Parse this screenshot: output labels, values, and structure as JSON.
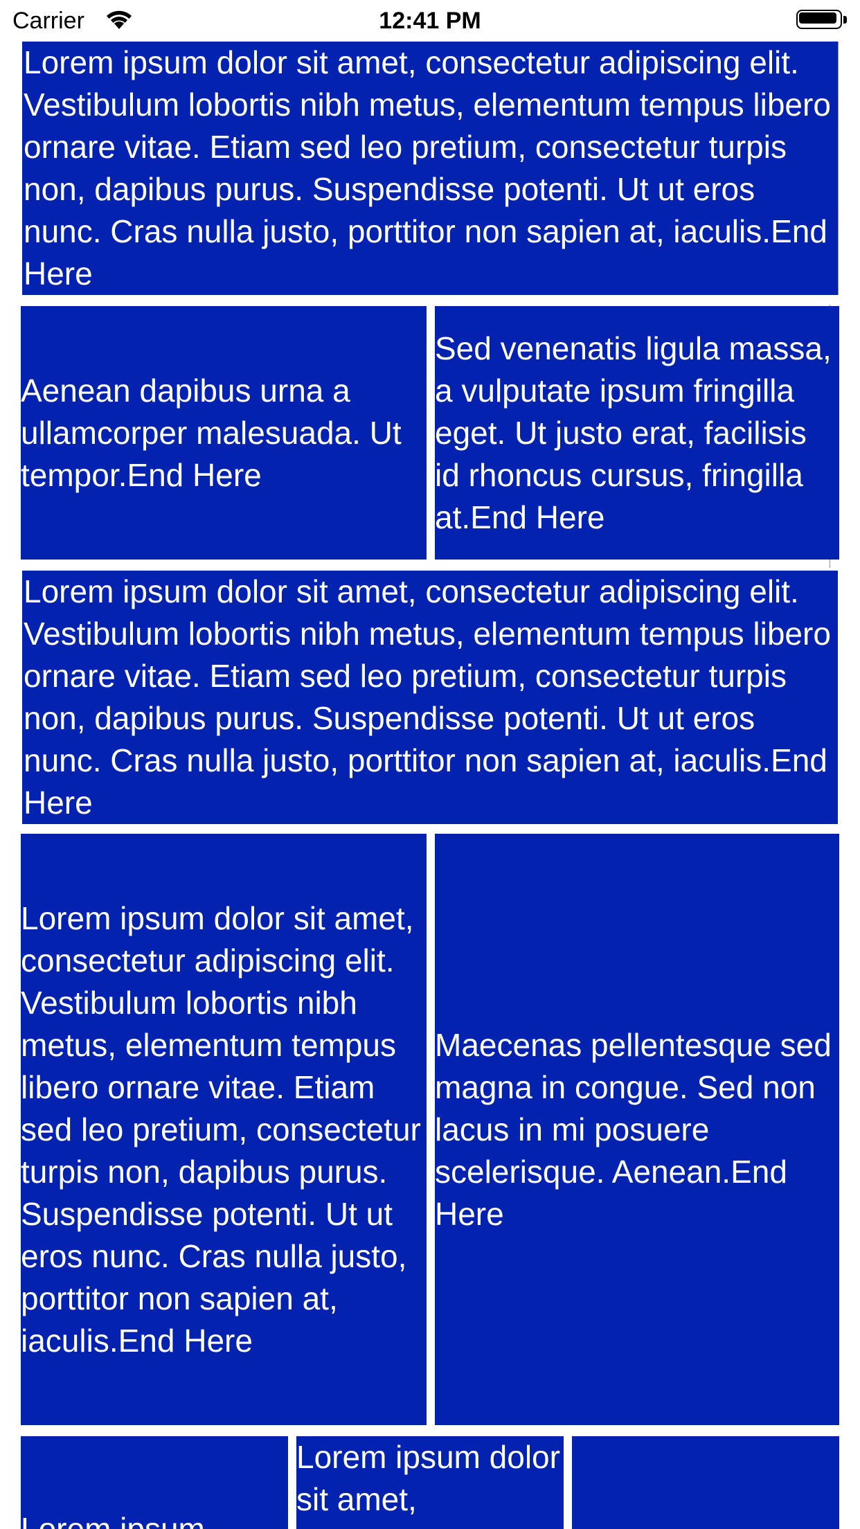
{
  "status_bar": {
    "carrier": "Carrier",
    "time": "12:41 PM",
    "battery_level": 1.0
  },
  "colors": {
    "cell_background": "#0322b0",
    "cell_text": "#ffffff"
  },
  "rows": [
    {
      "cells": [
        {
          "text": "Lorem ipsum dolor sit amet, consectetur adipiscing elit. Vestibulum lobortis nibh metus, elementum tempus libero ornare vitae. Etiam sed leo pretium, consectetur turpis non, dapibus purus. Suspendisse potenti. Ut ut eros nunc. Cras nulla justo, porttitor non sapien at, iaculis.End Here"
        }
      ]
    },
    {
      "cells": [
        {
          "text": "Aenean dapibus urna a ullamcorper malesuada. Ut tempor.End Here"
        },
        {
          "text": "Sed venenatis ligula massa, a vulputate ipsum fringilla eget. Ut justo erat, facilisis id rhoncus cursus, fringilla at.End Here"
        }
      ]
    },
    {
      "cells": [
        {
          "text": "Lorem ipsum dolor sit amet, consectetur adipiscing elit. Vestibulum lobortis nibh metus, elementum tempus libero ornare vitae. Etiam sed leo pretium, consectetur turpis non, dapibus purus. Suspendisse potenti. Ut ut eros nunc. Cras nulla justo, porttitor non sapien at, iaculis.End Here"
        }
      ]
    },
    {
      "cells": [
        {
          "text": "Lorem ipsum dolor sit amet, consectetur adipiscing elit. Vestibulum lobortis nibh metus, elementum tempus libero ornare vitae. Etiam sed leo pretium, consectetur turpis non, dapibus purus. Suspendisse potenti. Ut ut eros nunc. Cras nulla justo, porttitor non sapien at, iaculis.End Here"
        },
        {
          "text": "Maecenas pellentesque sed magna in congue. Sed non lacus in mi posuere scelerisque. Aenean.End Here"
        }
      ]
    },
    {
      "cells": [
        {
          "text": "Lorem ipsum"
        },
        {
          "text": "Lorem ipsum dolor sit amet,"
        },
        {
          "text": ""
        }
      ]
    }
  ]
}
